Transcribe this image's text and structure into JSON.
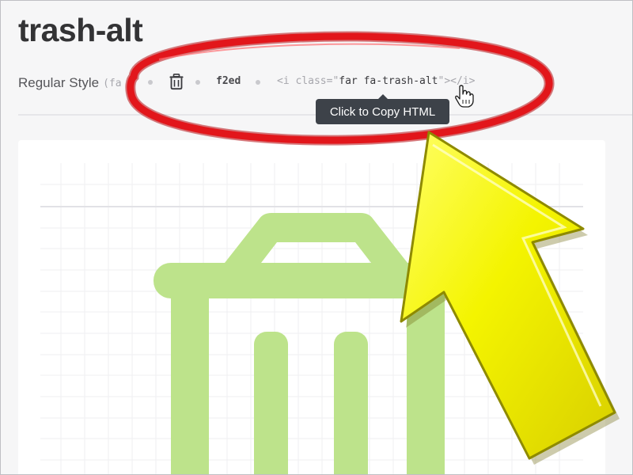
{
  "icon_page": {
    "title": "trash-alt",
    "style_label": "Regular Style",
    "style_prefix": "(fa",
    "unicode": "f2ed",
    "html_snippet": {
      "open": "<i class=\"",
      "classes": "far fa-trash-alt",
      "close": "\"></i>"
    }
  },
  "tooltip": {
    "text": "Click to Copy HTML"
  },
  "icons": {
    "meta_icon": "trash-alt-icon",
    "preview_icon": "trash-alt-icon",
    "cursor": "hand-pointer-cursor"
  },
  "annotations": {
    "circle_color": "#e2161b",
    "arrow_color": "#f4f400"
  },
  "colors": {
    "preview_icon": "#bde38b",
    "grid": "#ececef",
    "tooltip_bg": "#3d4249",
    "title": "#333335"
  }
}
